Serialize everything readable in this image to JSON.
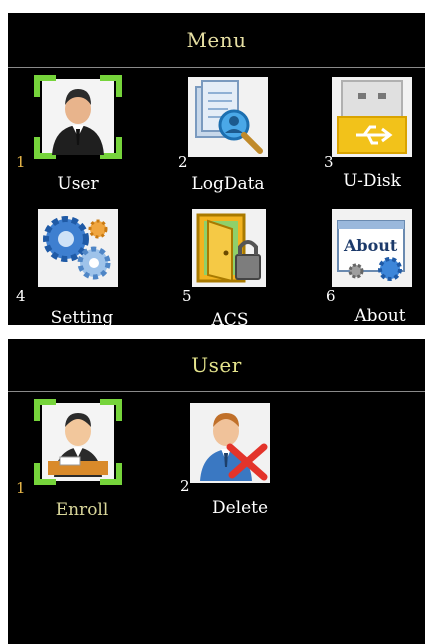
{
  "menu": {
    "title": "Menu",
    "items": [
      {
        "num": "1",
        "label": "User",
        "icon": "user-icon",
        "selected": true
      },
      {
        "num": "2",
        "label": "LogData",
        "icon": "logdata-icon"
      },
      {
        "num": "3",
        "label": "U-Disk",
        "icon": "usb-disk-icon"
      },
      {
        "num": "4",
        "label": "Setting",
        "icon": "settings-gears-icon"
      },
      {
        "num": "5",
        "label": "ACS",
        "icon": "access-control-icon"
      },
      {
        "num": "6",
        "label": "About",
        "icon": "about-icon",
        "about_text": "About"
      }
    ]
  },
  "user": {
    "title": "User",
    "items": [
      {
        "num": "1",
        "label": "Enroll",
        "icon": "enroll-user-icon",
        "selected": true
      },
      {
        "num": "2",
        "label": "Delete",
        "icon": "delete-user-icon"
      }
    ]
  },
  "colors": {
    "selection_green": "#76d43b",
    "selected_number": "#e9b84a",
    "title_text": "#e6dfa3"
  }
}
